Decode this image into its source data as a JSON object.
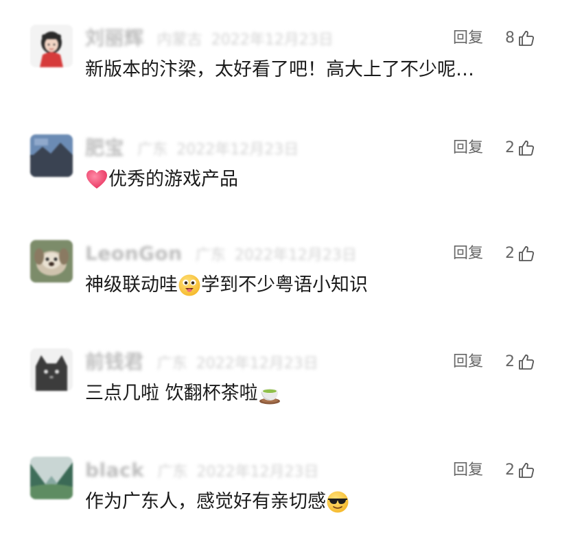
{
  "comments": [
    {
      "name": "刘丽辉",
      "location": "内蒙古",
      "date": "2022年12月23日",
      "reply_label": "回复",
      "likes": "8",
      "text": "新版本的汴梁，太好看了吧！高大上了不少呢…",
      "avatar": "avatar-girl-red",
      "emoji_before": null,
      "emoji_after": null
    },
    {
      "name": "肥宝",
      "location": "广东",
      "date": "2022年12月23日",
      "reply_label": "回复",
      "likes": "2",
      "text": "优秀的游戏产品",
      "avatar": "avatar-landscape-dark",
      "emoji_before": "heart-emoji",
      "emoji_after": null
    },
    {
      "name": "LeonGon",
      "location": "广东",
      "date": "2022年12月23日",
      "reply_label": "回复",
      "likes": "2",
      "text_a": "神级联动哇",
      "text_b": "学到不少粤语小知识",
      "avatar": "avatar-dog",
      "emoji_mid": "surprised-face-emoji"
    },
    {
      "name": "前钱君",
      "location": "广东",
      "date": "2022年12月23日",
      "reply_label": "回复",
      "likes": "2",
      "text": "三点几啦 饮翻杯茶啦",
      "avatar": "avatar-cat-dark",
      "emoji_before": null,
      "emoji_after": "tea-cup-emoji"
    },
    {
      "name": "black",
      "location": "广东",
      "date": "2022年12月23日",
      "reply_label": "回复",
      "likes": "2",
      "text": "作为广东人，感觉好有亲切感",
      "avatar": "avatar-valley-green",
      "emoji_before": null,
      "emoji_after": "sunglasses-face-emoji"
    }
  ],
  "colors": {
    "text": "#1a1a1a",
    "meta": "#c7c7c7",
    "action": "#666666"
  }
}
